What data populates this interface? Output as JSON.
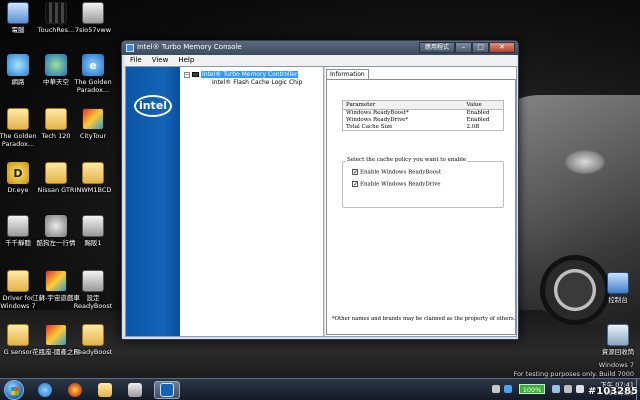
{
  "desktop_icons": [
    {
      "name": "computer",
      "label": "電腦",
      "icon": "computer-icon"
    },
    {
      "name": "touchres",
      "label": "TouchRes...",
      "icon": "film-icon"
    },
    {
      "name": "7sio57vww",
      "label": "7sio57vww",
      "icon": "app-icon"
    },
    {
      "name": "network",
      "label": "網路",
      "icon": "globe-icon"
    },
    {
      "name": "hwzkty",
      "label": "中華天空",
      "icon": "earth-icon"
    },
    {
      "name": "golden-paradox",
      "label": "The Golden Paradox...",
      "icon": "ie-icon"
    },
    {
      "name": "golden-paradox-2",
      "label": "The Golden Paradox...",
      "icon": "folder-icon"
    },
    {
      "name": "tech-120",
      "label": "Tech 120",
      "icon": "folder-icon"
    },
    {
      "name": "citytour",
      "label": "CityTour",
      "icon": "photo-icon"
    },
    {
      "name": "dreye",
      "label": "Dr.eye",
      "icon": "dr-icon"
    },
    {
      "name": "nissan-gtr",
      "label": "Nissan GTR",
      "icon": "folder-icon"
    },
    {
      "name": "inwm1bcd",
      "label": "INWM1BCD",
      "icon": "folder-icon"
    },
    {
      "name": "qqtx",
      "label": "千千靜聽",
      "icon": "app-icon"
    },
    {
      "name": "nbx",
      "label": "酷狗左一行情",
      "icon": "gear-icon"
    },
    {
      "name": "tjl",
      "label": "賜阪1",
      "icon": "app-icon"
    },
    {
      "name": "driver-win7",
      "label": "Driver for Windows 7",
      "icon": "folder-icon"
    },
    {
      "name": "jxgmh",
      "label": "江蘇-宇宙遊戲車",
      "icon": "photo-icon"
    },
    {
      "name": "readyboost-set",
      "label": "設定 ReadyBoost",
      "icon": "app-icon"
    },
    {
      "name": "g-sensor",
      "label": "G sensor",
      "icon": "folder-icon"
    },
    {
      "name": "ytcm",
      "label": "花瓶座-國產之間",
      "icon": "photo-icon"
    },
    {
      "name": "readyboost",
      "label": "ReadyBoost",
      "icon": "folder-icon"
    },
    {
      "name": "control-panel",
      "label": "控制台",
      "icon": "panel-icon"
    },
    {
      "name": "recycle-bin",
      "label": "資源回收筒",
      "icon": "bin-icon"
    }
  ],
  "window": {
    "title": "Intel® Turbo Memory Console",
    "title_right": "應用程式",
    "minimize": "–",
    "maximize": "□",
    "close": "✕",
    "menu": [
      "File",
      "View",
      "Help"
    ],
    "logo_text": "intel",
    "tree": {
      "expander": "−",
      "root": "Intel® Turbo Memory Controller",
      "child": "Intel® Flash Cache Logic Chip"
    },
    "tab": "Information",
    "table": {
      "headers": [
        "Parameter",
        "Value"
      ],
      "rows": [
        [
          "Windows ReadyBoost*",
          "Enabled"
        ],
        [
          "Windows ReadyDrive*",
          "Enabled"
        ],
        [
          "Total Cache Size",
          "2.0B"
        ]
      ]
    },
    "policy": {
      "legend": "Select the cache policy you want to enable",
      "options": [
        {
          "label": "Enable Windows ReadyBoost",
          "checked": true
        },
        {
          "label": "Enable Windows ReadyDrive",
          "checked": true
        }
      ],
      "check_glyph": "✓"
    },
    "footnote": "*Other names and brands may be claimed as the property of others."
  },
  "watermark": {
    "line1": "Windows 7",
    "line2": "For testing purposes only. Build 7000"
  },
  "taskbar": {
    "battery": "100%",
    "clock_time": "下午 07:41",
    "clock_date": "2009/3/8"
  },
  "badge": "#103285",
  "colors": {
    "intel_blue": "#1364b8",
    "selection": "#3399ff",
    "battery_green": "#34b233"
  }
}
